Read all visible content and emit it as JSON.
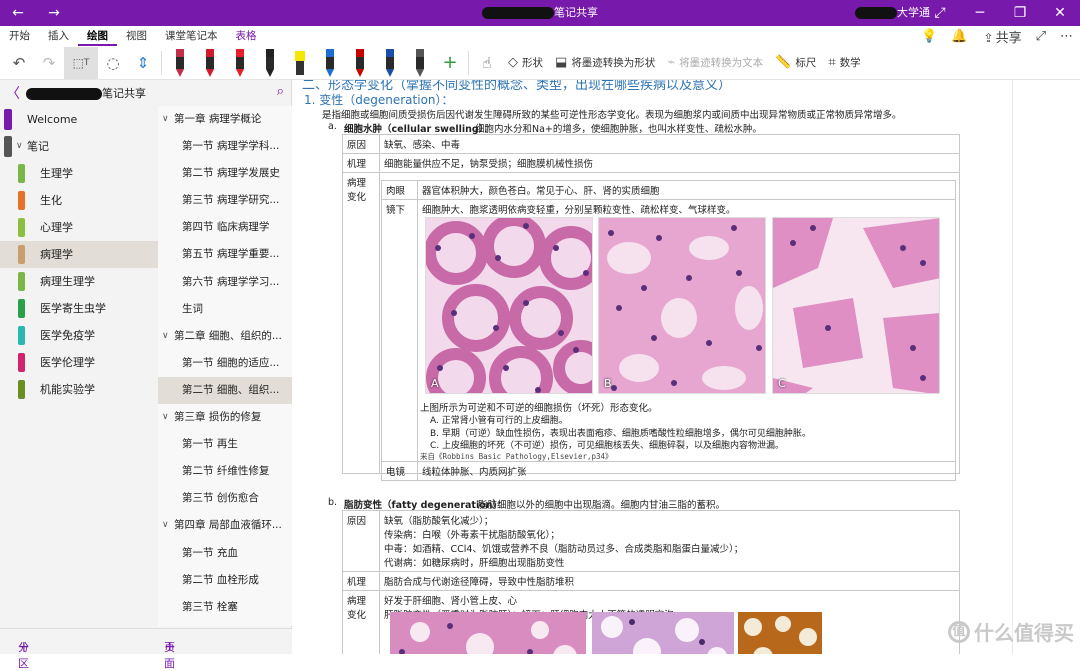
{
  "titlebar": {
    "title_suffix": "笔记共享",
    "user_suffix": "大学通",
    "back_icon": "back-arrow-icon",
    "forward_icon": "forward-arrow-icon",
    "bg_color": "#7719aa"
  },
  "menu": {
    "tabs": [
      "开始",
      "插入",
      "绘图",
      "视图",
      "课堂笔记本",
      "表格"
    ],
    "active_tab": "绘图",
    "share_label": "共享"
  },
  "toolbar": {
    "shapes_label": "形状",
    "ink_to_shape_label": "将墨迹转换为形状",
    "ink_to_text_label": "将墨迹转换为文本",
    "ruler_label": "标尺",
    "math_label": "数学",
    "pens": [
      {
        "color": "#c0304a",
        "kind": "pen"
      },
      {
        "color": "#d11a2a",
        "kind": "pen"
      },
      {
        "color": "#e8202a",
        "kind": "pen"
      },
      {
        "color": "#222222",
        "kind": "pen"
      },
      {
        "color": "#f5e800",
        "kind": "highlighter"
      },
      {
        "color": "#1a6fd1",
        "kind": "pen"
      },
      {
        "color": "#c80000",
        "kind": "pen"
      },
      {
        "color": "#1b4ea8",
        "kind": "pen"
      },
      {
        "color": "#555555",
        "kind": "pencil"
      }
    ]
  },
  "nav": {
    "notebook_suffix": "笔记共享",
    "welcome": "Welcome",
    "group_label": "笔记",
    "sections": [
      {
        "label": "生理学",
        "color": "#7ab648"
      },
      {
        "label": "生化",
        "color": "#e8712a"
      },
      {
        "label": "心理学",
        "color": "#8cbf3f"
      },
      {
        "label": "病理学",
        "color": "#c8a070"
      },
      {
        "label": "病理生理学",
        "color": "#7ab648"
      },
      {
        "label": "医学寄生虫学",
        "color": "#2aa04a"
      },
      {
        "label": "医学免疫学",
        "color": "#2bb7b0"
      },
      {
        "label": "医学伦理学",
        "color": "#d0246c"
      },
      {
        "label": "机能实验学",
        "color": "#6b8e23"
      }
    ],
    "selected_section": "病理学",
    "pages": [
      {
        "label": "第一章  病理学概论",
        "level": 0
      },
      {
        "label": "第一节  病理学学科...",
        "level": 1
      },
      {
        "label": "第二节  病理学发展史",
        "level": 1
      },
      {
        "label": "第三节  病理学研究...",
        "level": 1
      },
      {
        "label": "第四节  临床病理学",
        "level": 1
      },
      {
        "label": "第五节  病理学重要...",
        "level": 1
      },
      {
        "label": "第六节  病理学学习...",
        "level": 1
      },
      {
        "label": "生词",
        "level": 1
      },
      {
        "label": "第二章  细胞、组织的...",
        "level": 0
      },
      {
        "label": "第一节  细胞的适应...",
        "level": 1
      },
      {
        "label": "第二节  细胞、组织...",
        "level": 1
      },
      {
        "label": "第三章  损伤的修复",
        "level": 0
      },
      {
        "label": "第一节  再生",
        "level": 1
      },
      {
        "label": "第二节  纤维性修复",
        "level": 1
      },
      {
        "label": "第三节  创伤愈合",
        "level": 1
      },
      {
        "label": "第四章  局部血液循环...",
        "level": 0
      },
      {
        "label": "第一节  充血",
        "level": 1
      },
      {
        "label": "第二节  血栓形成",
        "level": 1
      },
      {
        "label": "第三节  栓塞",
        "level": 1
      }
    ],
    "selected_page_index": 10,
    "add_section": "分区",
    "add_page": "页面"
  },
  "content": {
    "heading_top": "二、形态学变化（掌握不同变性的概念、类型，出现在哪些疾病以及意义）",
    "h1": "1.  变性（degeneration）：",
    "intro": "是指细胞或细胞间质受损伤后因代谢发生障碍所致的某些可逆性形态学变化。表现为细胞浆内或间质中出现异常物质或正常物质异常增多。",
    "a_marker": "a.",
    "a_title": "细胞水肿（cellular swelling）：",
    "a_desc": "细胞内水分和Na+的增多，使细胞肿胀，也叫水样变性、疏松水肿。",
    "table_a": {
      "cause_label": "原因",
      "cause": "缺氧、感染、中毒",
      "mech_label": "机理",
      "mech": "细胞能量供应不足，钠泵受损；细胞膜机械性损伤",
      "path_label": "病理变化",
      "gross_label": "肉眼",
      "gross": "器官体积肿大，颜色苍白。常见于心、肝、肾的实质细胞",
      "micro_label": "镜下",
      "micro": "细胞肿大、胞浆透明依病变轻重，分别呈颗粒变性、疏松样变、气球样变。",
      "img_labels": [
        "A",
        "B",
        "C"
      ],
      "caption": "上图所示为可逆和不可逆的细胞损伤（坏死）形态变化。",
      "caption_a": "A. 正常肾小管有可行的上皮细胞。",
      "caption_b": "B. 早期（可逆）缺血性损伤，表现出表面疱疹、细胞质嗜酸性粒细胞增多，偶尔可见细胞肿胀。",
      "caption_c": "C. 上皮细胞的坏死（不可逆）损伤，可见细胞核丢失、细胞碎裂，以及细胞内容物泄漏。",
      "source": "来自《Robbins Basic Pathology,Elsevier,p34》",
      "em_label": "电镜",
      "em": "线粒体肿胀、内质网扩张"
    },
    "b_marker": "b.",
    "b_title": "脂肪变性（fatty degeneration）：",
    "b_desc": "脂肪细胞以外的细胞中出现脂滴。细胞内甘油三脂的蓄积。",
    "table_b": {
      "cause_label": "原因",
      "causes": [
        "缺氧（脂肪酸氧化减少）；",
        "传染病：白喉（外毒素干扰脂肪酸氧化）；",
        "中毒：如酒精、CCl4、饥饿或营养不良（脂肪动员过多、合成类脂和脂蛋白量减少）；",
        "代谢病：如糖尿病时，肝细胞出现脂肪变性"
      ],
      "mech_label": "机理",
      "mech": "脂肪合成与代谢途径障碍，导致中性脂肪堆积",
      "path_label": "病理变化",
      "path1": "好发于肝细胞、肾小管上皮、心",
      "path2": "肝脂肪变性（严重时为脂肪肝）；镜下：肝细胞内大小不等的透明空泡"
    }
  },
  "watermark": "什么值得买"
}
